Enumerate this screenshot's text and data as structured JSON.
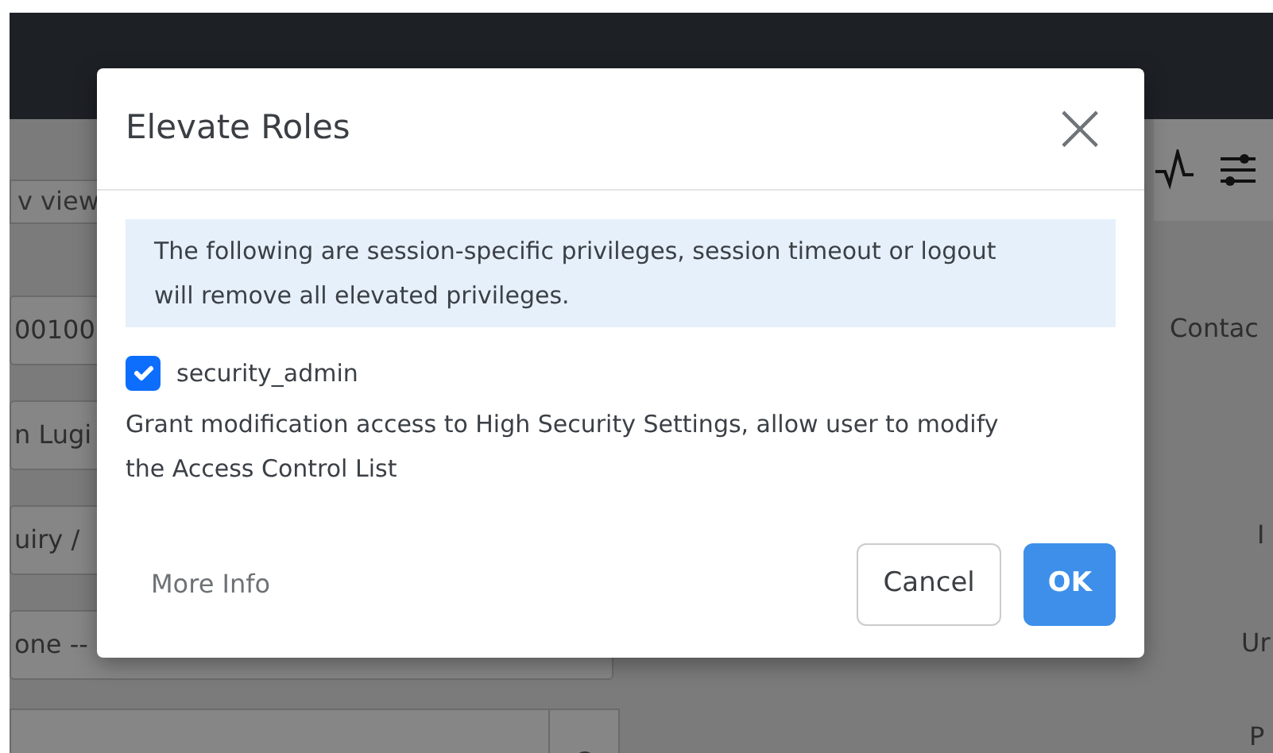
{
  "background": {
    "left_items": [
      {
        "kind": "button",
        "text": "v view"
      },
      {
        "kind": "field",
        "text": "00100"
      },
      {
        "kind": "field",
        "text": "n Lugi"
      },
      {
        "kind": "field",
        "text": "uiry /"
      },
      {
        "kind": "field",
        "text": "one --"
      },
      {
        "kind": "search"
      }
    ],
    "right_labels": [
      "Contac",
      "I",
      "Ur",
      "P"
    ]
  },
  "dialog": {
    "title": "Elevate Roles",
    "close": "×",
    "notice": "The following are session-specific privileges, session timeout or logout will remove all elevated privileges.",
    "roles": [
      {
        "name": "security_admin",
        "checked": true,
        "description": "Grant modification access to High Security Settings, allow user to modify the Access Control List"
      }
    ],
    "more_info": "More Info",
    "buttons": [
      {
        "kind": "secondary",
        "label": "Cancel"
      },
      {
        "kind": "primary",
        "label": "OK"
      }
    ]
  }
}
